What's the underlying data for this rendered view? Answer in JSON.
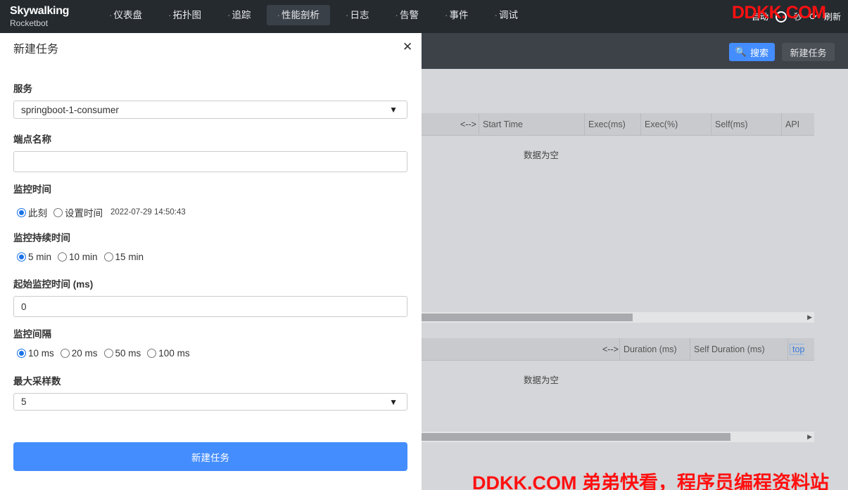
{
  "app": {
    "logo_title": "Skywalking",
    "logo_subtitle": "Rocketbot"
  },
  "nav": {
    "items": [
      {
        "label": "仪表盘"
      },
      {
        "label": "拓扑图"
      },
      {
        "label": "追踪"
      },
      {
        "label": "性能剖析"
      },
      {
        "label": "日志"
      },
      {
        "label": "告警"
      },
      {
        "label": "事件"
      },
      {
        "label": "调试"
      }
    ],
    "active_index": 3,
    "auto_label": "自动",
    "seconds_label": "秒",
    "refresh_label": "刷新"
  },
  "toolbar": {
    "search_label": "搜索",
    "new_task_label": "新建任务"
  },
  "grid1": {
    "columns": [
      "<-->",
      "Start Time",
      "Exec(ms)",
      "Exec(%)",
      "Self(ms)",
      "API"
    ],
    "empty_text": "数据为空"
  },
  "grid2": {
    "columns": [
      "<-->",
      "Duration (ms)",
      "Self Duration (ms)",
      "top sl"
    ],
    "empty_text": "数据为空"
  },
  "drawer": {
    "title": "新建任务",
    "service_label": "服务",
    "service_value": "springboot-1-consumer",
    "endpoint_label": "端点名称",
    "endpoint_value": "",
    "monitor_time_label": "监控时间",
    "monitor_time_options": [
      "此刻",
      "设置时间"
    ],
    "monitor_time_selected": 0,
    "monitor_time_value": "2022-07-29 14:50:43",
    "duration_label": "监控持续时间",
    "duration_options": [
      "5 min",
      "10 min",
      "15 min"
    ],
    "duration_selected": 0,
    "min_threshold_label": "起始监控时间 (ms)",
    "min_threshold_value": "0",
    "interval_label": "监控间隔",
    "interval_options": [
      "10 ms",
      "20 ms",
      "50 ms",
      "100 ms"
    ],
    "interval_selected": 0,
    "max_sampling_label": "最大采样数",
    "max_sampling_value": "5",
    "submit_label": "新建任务"
  },
  "watermark": {
    "top": "DDKK.COM",
    "bottom": "DDKK.COM 弟弟快看，程序员编程资料站"
  },
  "colors": {
    "topbar": "#252a2f",
    "accent": "#448dfe",
    "watermark": "#ff1010"
  }
}
